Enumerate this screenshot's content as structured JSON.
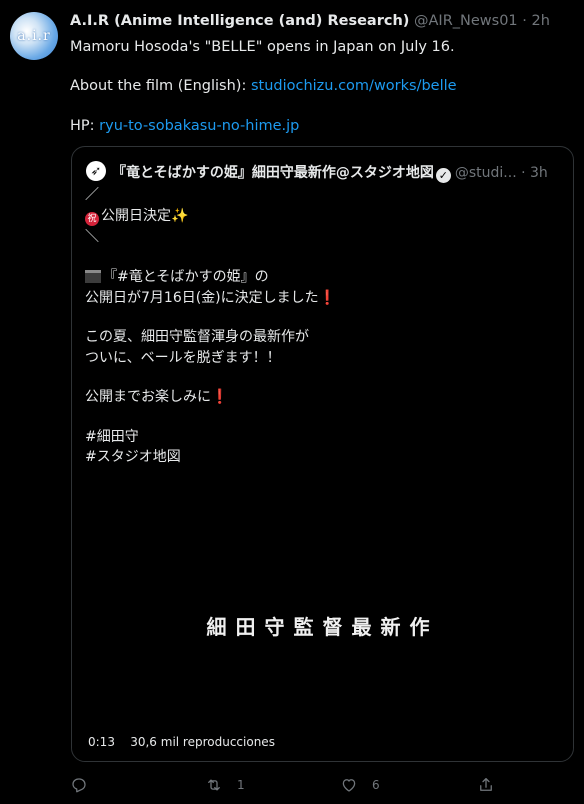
{
  "tweet": {
    "avatar_text": "a.i.r",
    "author_name": "A.I.R (Anime Intelligence (and) Research)",
    "handle": "@AIR_News01",
    "separator": "·",
    "time": "2h",
    "line1": "Mamoru Hosoda's \"BELLE\" opens in Japan on July 16.",
    "line2_prefix": "About the film (English): ",
    "line2_link": "studiochizu.com/works/belle",
    "line3_prefix": "HP: ",
    "line3_link": "ryu-to-sobakasu-no-hime.jp"
  },
  "quote": {
    "author_name": "『竜とそばかすの姫』細田守最新作@スタジオ地図",
    "verified_icon": "✓",
    "handle": "@studi...",
    "separator": "·",
    "time": "3h",
    "lines": {
      "l1": "／",
      "l2_badge": "祝",
      "l2_text": "公開日決定",
      "l2_sparkle": "✨",
      "l3": "＼",
      "l4": "『#竜とそばかすの姫』の",
      "l5_text": "公開日が7月16日(金)に決定しました",
      "l5_mark": "❗",
      "l6": "この夏、細田守監督渾身の最新作が",
      "l7": "ついに、ベールを脱ぎます！！",
      "l8_text": "公開までお楽しみに",
      "l8_mark": "❗",
      "l9": "#細田守",
      "l10": "#スタジオ地図"
    },
    "video": {
      "title": "細田守監督最新作",
      "time": "0:13",
      "views": "30,6 mil reproducciones"
    }
  },
  "actions": {
    "reply_count": "",
    "retweet_count": "1",
    "like_count": "6"
  },
  "colors": {
    "background": "#000000",
    "link": "#1d9bf0",
    "muted": "#71767b",
    "border": "#2f3336"
  },
  "icons": [
    "reply-icon",
    "retweet-icon",
    "like-icon",
    "share-icon",
    "verified-icon",
    "clapperboard-icon",
    "celebration-sign-icon",
    "sparkles-icon"
  ]
}
